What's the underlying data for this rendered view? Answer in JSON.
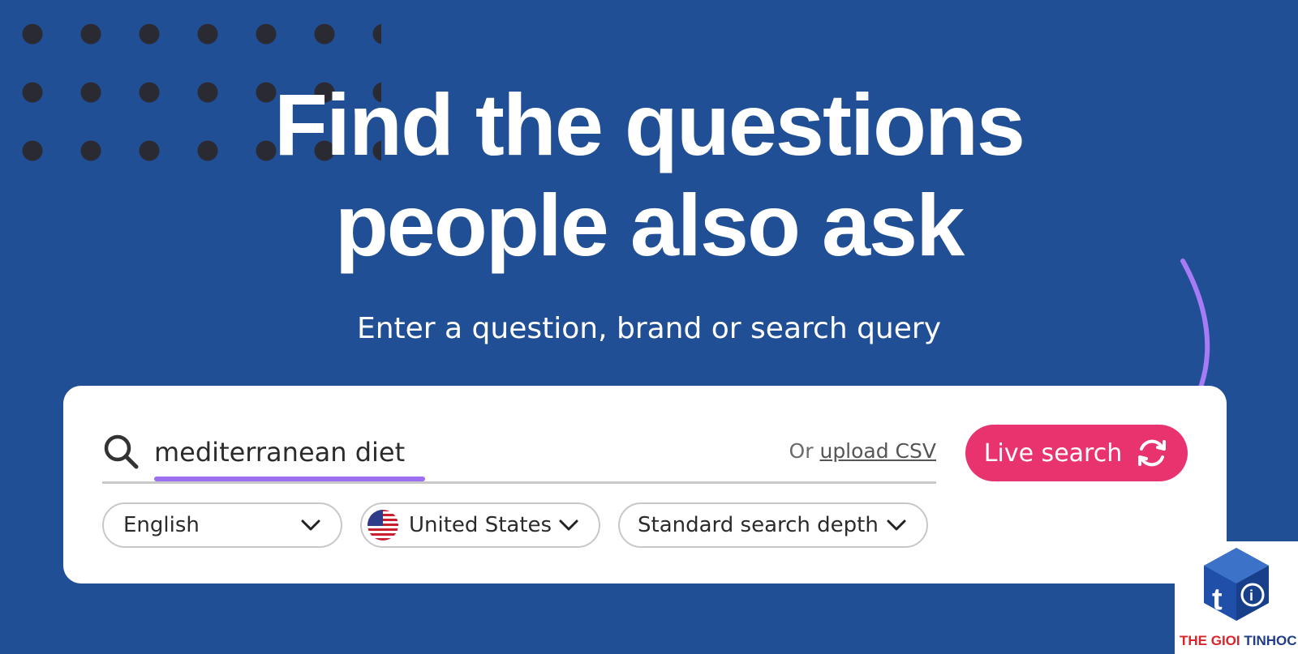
{
  "hero": {
    "headline_line1": "Find the questions",
    "headline_line2": "people also ask",
    "subtitle": "Enter a question, brand or search query"
  },
  "search": {
    "value": "mediterranean diet",
    "or_text": "Or",
    "upload_link": "upload CSV",
    "button_label": "Live search"
  },
  "filters": {
    "language": "English",
    "country": "United States",
    "depth": "Standard search depth"
  },
  "logo": {
    "part1": "THE GIOI",
    "part2": " TINHOC"
  },
  "colors": {
    "background": "#214f95",
    "accent": "#e8336f",
    "highlight": "#9b6ff0"
  },
  "icons": [
    "search-icon",
    "refresh-icon",
    "chevron-down-icon",
    "us-flag-icon",
    "curved-arrow-icon"
  ]
}
